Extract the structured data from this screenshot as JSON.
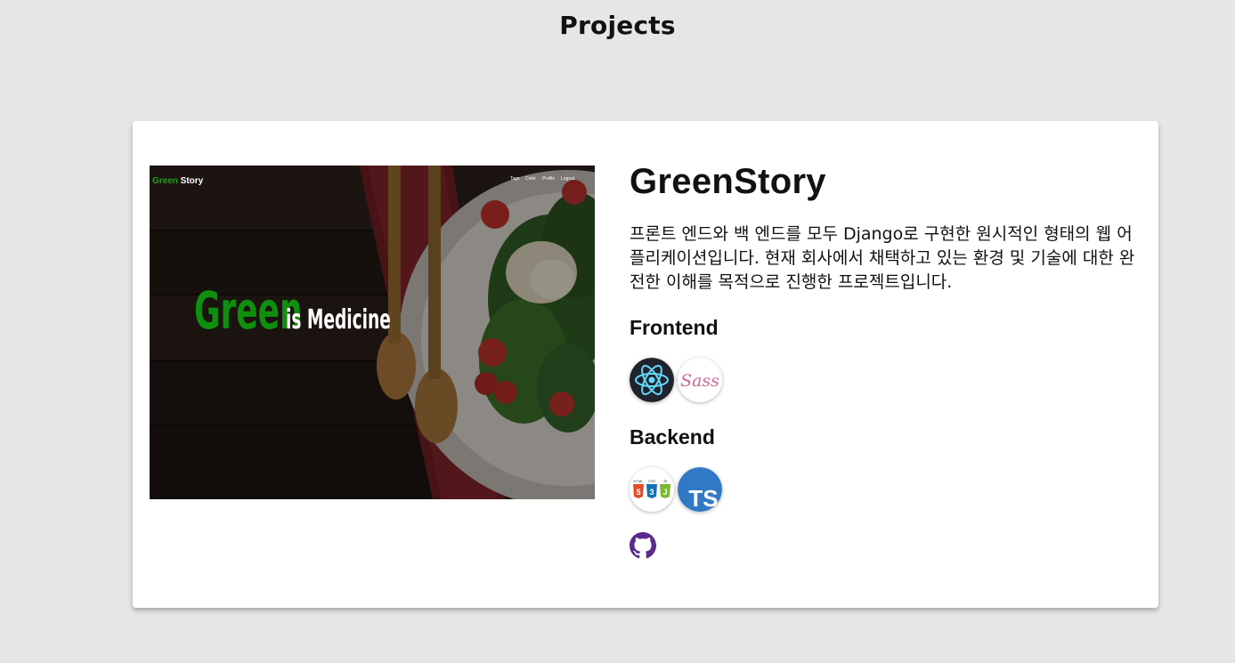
{
  "page": {
    "title": "Projects"
  },
  "project": {
    "name": "GreenStory",
    "description": "프론트 엔드와 백 엔드를 모두 Django로 구현한 원시적인 형태의 웹 어플리케이션입니다. 현재 회사에서 채택하고 있는 환경 및 기술에 대한 완전한 이해를 목적으로 진행한 프로젝트입니다.",
    "thumbnail": {
      "logo_green": "Green",
      "logo_rest": " Story",
      "nav": [
        "Tags",
        "Color",
        "Profile",
        "Logout"
      ],
      "headline_green": "Green",
      "headline_rest": "is Medicine"
    },
    "frontend": {
      "title": "Frontend",
      "icons": [
        "react-icon",
        "sass-icon"
      ]
    },
    "backend": {
      "title": "Backend",
      "icons": [
        "html-css-js-icon",
        "typescript-icon"
      ],
      "ts_label": "TS",
      "html_label": "HTML",
      "css_label": "CSS",
      "js_label": "JS"
    },
    "github_icon": "github-icon"
  },
  "colors": {
    "background": "#e6e6e6",
    "card": "#ffffff",
    "brand_green": "#109010",
    "react_blue": "#61dafb",
    "sass_pink": "#cd6799",
    "ts_blue": "#3178c6",
    "github_purple": "#5b2a8a"
  }
}
